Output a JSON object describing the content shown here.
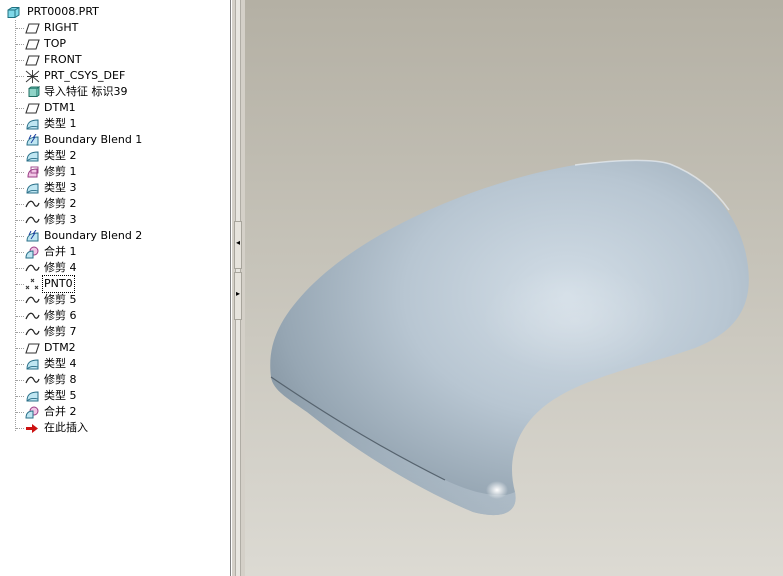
{
  "tree": {
    "root": "PRT0008.PRT",
    "items": [
      {
        "label": "RIGHT",
        "icon": "datum-plane-icon"
      },
      {
        "label": "TOP",
        "icon": "datum-plane-icon"
      },
      {
        "label": "FRONT",
        "icon": "datum-plane-icon"
      },
      {
        "label": "PRT_CSYS_DEF",
        "icon": "coordinate-system-icon"
      },
      {
        "label": "导入特征 标识39",
        "icon": "import-feature-icon"
      },
      {
        "label": "DTM1",
        "icon": "datum-plane-icon"
      },
      {
        "label": "类型 1",
        "icon": "surface-icon"
      },
      {
        "label": "Boundary Blend 1",
        "icon": "boundary-blend-icon"
      },
      {
        "label": "类型 2",
        "icon": "surface-icon"
      },
      {
        "label": "修剪 1",
        "icon": "trim-surface-icon"
      },
      {
        "label": "类型 3",
        "icon": "surface-icon"
      },
      {
        "label": "修剪 2",
        "icon": "curve-icon"
      },
      {
        "label": "修剪 3",
        "icon": "curve-icon"
      },
      {
        "label": "Boundary Blend 2",
        "icon": "boundary-blend-icon"
      },
      {
        "label": "合并 1",
        "icon": "merge-icon"
      },
      {
        "label": "修剪 4",
        "icon": "curve-icon"
      },
      {
        "label": "PNT0",
        "icon": "datum-point-icon",
        "selected": true
      },
      {
        "label": "修剪 5",
        "icon": "curve-icon"
      },
      {
        "label": "修剪 6",
        "icon": "curve-icon"
      },
      {
        "label": "修剪 7",
        "icon": "curve-icon"
      },
      {
        "label": "DTM2",
        "icon": "datum-plane-icon"
      },
      {
        "label": "类型 4",
        "icon": "surface-icon"
      },
      {
        "label": "修剪 8",
        "icon": "curve-icon"
      },
      {
        "label": "类型 5",
        "icon": "surface-icon"
      },
      {
        "label": "合并 2",
        "icon": "merge-icon"
      },
      {
        "label": "在此插入",
        "icon": "insert-here-arrow-icon"
      }
    ]
  },
  "splitter": {
    "collapse_glyph": "◂",
    "expand_glyph": "▸"
  },
  "colors": {
    "part_surface": "#b4c2ce",
    "viewport_top": "#b4b0a4",
    "viewport_bottom": "#dcdad3",
    "insert_arrow": "#cc1111"
  }
}
